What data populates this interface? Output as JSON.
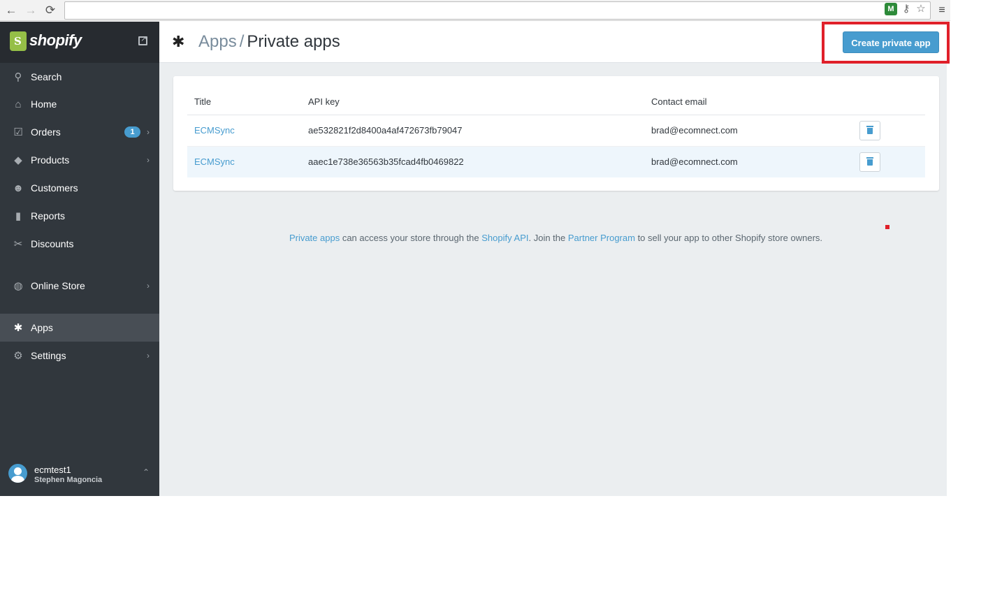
{
  "browser": {
    "back_icon": "←",
    "forward_icon": "→",
    "reload_icon": "⟳",
    "url": "",
    "menu_icon": "≡"
  },
  "sidebar": {
    "brand": "shopify",
    "items": [
      {
        "label": "Search",
        "icon": "search-icon"
      },
      {
        "label": "Home",
        "icon": "home-icon"
      },
      {
        "label": "Orders",
        "icon": "orders-icon",
        "badge": "1"
      },
      {
        "label": "Products",
        "icon": "tag-icon"
      },
      {
        "label": "Customers",
        "icon": "customers-icon"
      },
      {
        "label": "Reports",
        "icon": "bar-chart-icon"
      },
      {
        "label": "Discounts",
        "icon": "discount-icon"
      },
      {
        "label": "Online Store",
        "icon": "globe-icon"
      },
      {
        "label": "Apps",
        "icon": "puzzle-icon",
        "active": true
      },
      {
        "label": "Settings",
        "icon": "gear-icon"
      }
    ],
    "user": {
      "store": "ecmtest1",
      "name": "Stephen Magoncia"
    }
  },
  "header": {
    "breadcrumb_parent": "Apps",
    "breadcrumb_sep": "/",
    "title": "Private apps",
    "create_button": "Create private app"
  },
  "table": {
    "columns": [
      "Title",
      "API key",
      "Contact email"
    ],
    "rows": [
      {
        "title": "ECMSync",
        "api_key": "ae532821f2d8400a4af472673fb79047",
        "email": "brad@ecomnect.com"
      },
      {
        "title": "ECMSync",
        "api_key": "aaec1e738e36563b35fcad4fb0469822",
        "email": "brad@ecomnect.com"
      }
    ]
  },
  "footnote": {
    "link1": "Private apps",
    "text1": " can access your store through the ",
    "link2": "Shopify API",
    "text2": ". Join the ",
    "link3": "Partner Program",
    "text3": " to sell your app to other Shopify store owners."
  },
  "colors": {
    "accent": "#479ccf",
    "sidebar": "#31373d",
    "highlight": "#e0202a"
  }
}
